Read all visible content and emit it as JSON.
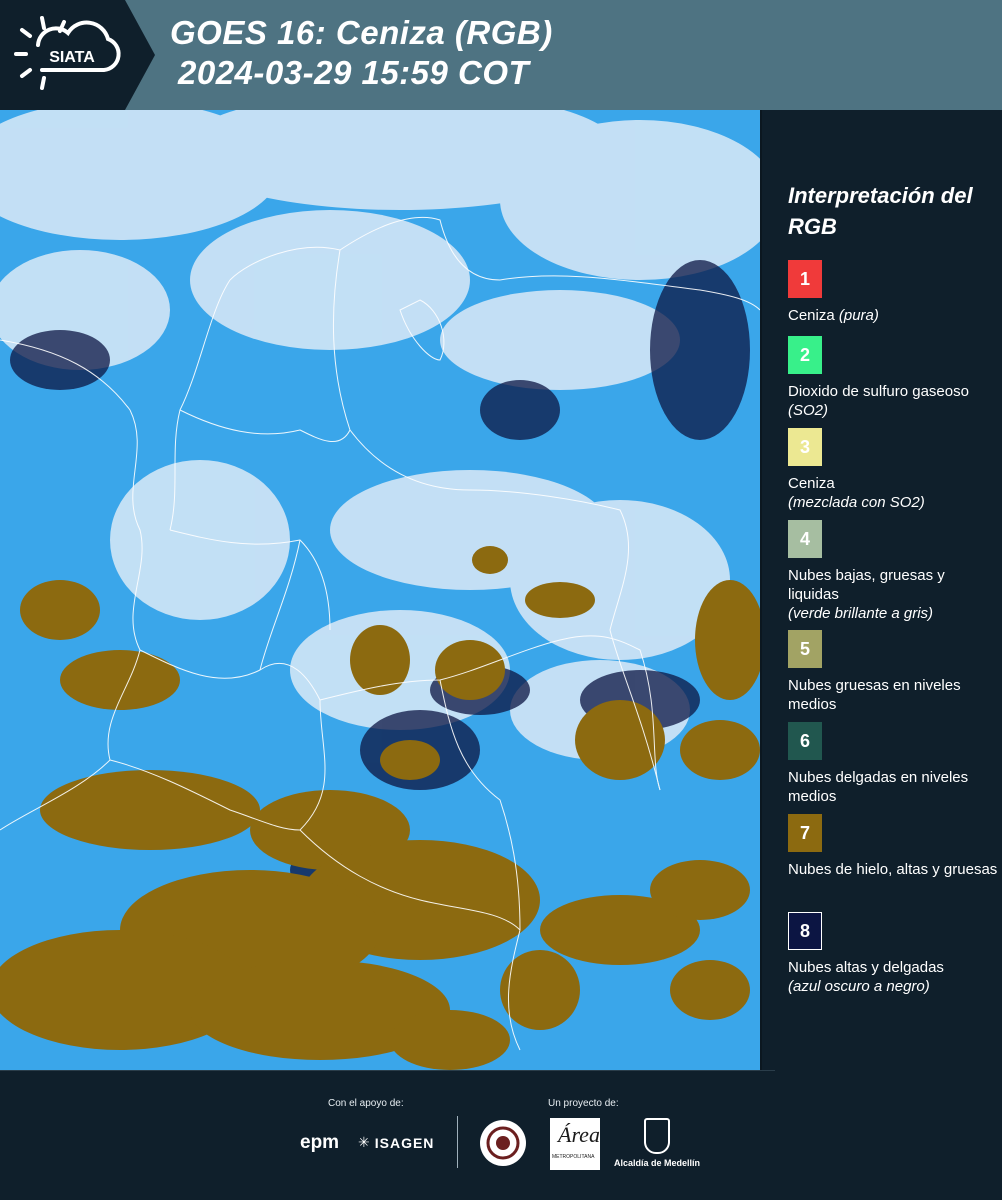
{
  "header": {
    "logo_text": "SIATA",
    "title": "GOES 16: Ceniza (RGB)",
    "timestamp": "2024-03-29 15:59 COT"
  },
  "legend": {
    "title": "Interpretación del RGB",
    "items": [
      {
        "number": "1",
        "color": "#f03a3a",
        "label": "Ceniza",
        "note": "(pura)"
      },
      {
        "number": "2",
        "color": "#38f08a",
        "label": "Dioxido de sulfuro gaseoso",
        "note": "(SO2)"
      },
      {
        "number": "3",
        "color": "#ece892",
        "label": "Ceniza",
        "note": "(mezclada con SO2)"
      },
      {
        "number": "4",
        "color": "#a6bea1",
        "label": "Nubes bajas, gruesas y liquidas",
        "note": "(verde brillante a gris)"
      },
      {
        "number": "5",
        "color": "#a2a364",
        "label": "Nubes gruesas en niveles medios",
        "note": ""
      },
      {
        "number": "6",
        "color": "#21574f",
        "label": "Nubes delgadas en niveles medios",
        "note": ""
      },
      {
        "number": "7",
        "color": "#8c6a10",
        "label": "Nubes de hielo, altas y gruesas",
        "note": ""
      },
      {
        "number": "8",
        "color": "#0c1543",
        "label": "Nubes altas y delgadas",
        "note": "(azul oscuro a negro)"
      }
    ]
  },
  "map": {
    "background_color": "#3aa6ea",
    "cloud_color_thick_ice": "#8c6a10",
    "cloud_color_thin_high": "#0c1543",
    "cloud_color_light": "#dbeaf7",
    "border_color": "#ffffff"
  },
  "footer": {
    "support_label": "Con el apoyo de:",
    "project_label": "Un proyecto de:",
    "sponsors": [
      "epm",
      "ISAGEN"
    ],
    "area_metropolitana": "Área",
    "area_subtext": "METROPOLITANA",
    "alcaldia": "Alcaldía de Medellín"
  }
}
